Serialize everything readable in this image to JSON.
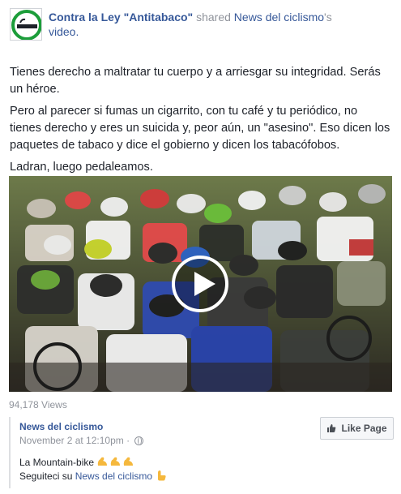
{
  "post": {
    "page_name": "Contra la Ley \"Antitabaco\"",
    "shared_word": " shared ",
    "shared_link": "News del ciclismo",
    "shared_suffix": "'s",
    "shared_object": "video."
  },
  "body": {
    "p1": "Tienes derecho a maltratar tu cuerpo y a arriesgar su integridad. Serás un héroe.",
    "p2": "Pero al parecer si fumas un cigarrito, con tu café y tu periódico, no tienes derecho y eres un suicida y, peor aún, un \"asesino\". Eso dicen los paquetes de tabaco y dice el gobierno y dicen los tabacófobos.",
    "p3": "Ladran, luego pedaleamos."
  },
  "video": {
    "views": "94,178 Views",
    "play_icon": "play-icon"
  },
  "shared_page": {
    "name": "News del ciclismo",
    "date": "November 2 at 12:10pm ·",
    "like_label": "Like Page",
    "line1": "La Mountain-bike ",
    "line2_prefix": "Seguiteci su ",
    "line2_link": "News del ciclismo"
  },
  "colors": {
    "link": "#365899",
    "muted": "#90949c",
    "text": "#1d2129"
  }
}
